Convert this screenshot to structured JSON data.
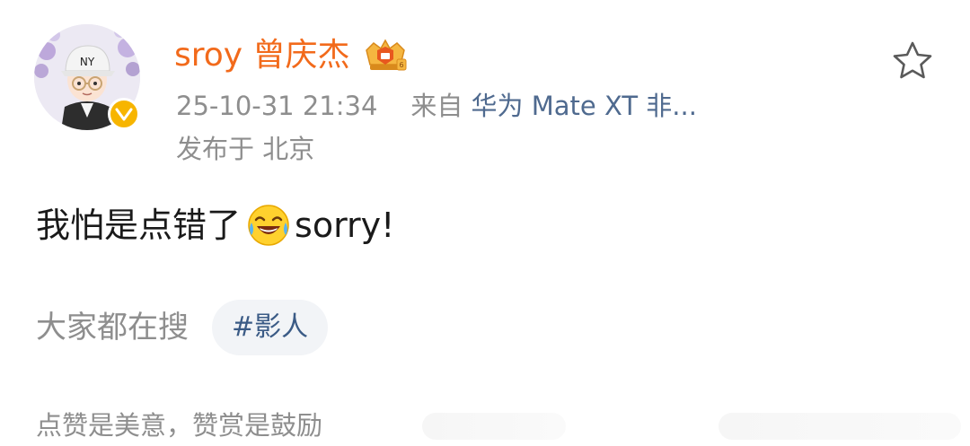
{
  "post": {
    "author": {
      "name": "sroy 曾庆杰",
      "avatar": "cartoon-boy-avatar",
      "verified": true,
      "verified_color": "#f7b500",
      "badge": "vip-crown-badge",
      "name_color": "#f26a1b"
    },
    "time": "25-10-31 21:34",
    "source_prefix": "来自",
    "source_device": "华为 Mate XT 非...",
    "location": "发布于 北京",
    "content": {
      "text_before": "我怕是点错了",
      "emoji": "laugh-cry-emoji",
      "text_after": "sorry!"
    },
    "trending": {
      "label": "大家都在搜",
      "topic": "#影人"
    },
    "footer": "点赞是美意，赞赏是鼓励",
    "favorite_icon": "star-outline-icon"
  },
  "colors": {
    "link": "#4f6a8f",
    "muted": "#8e8e8e",
    "topic": "#3b5b86",
    "chip_bg": "#f2f4f7"
  }
}
